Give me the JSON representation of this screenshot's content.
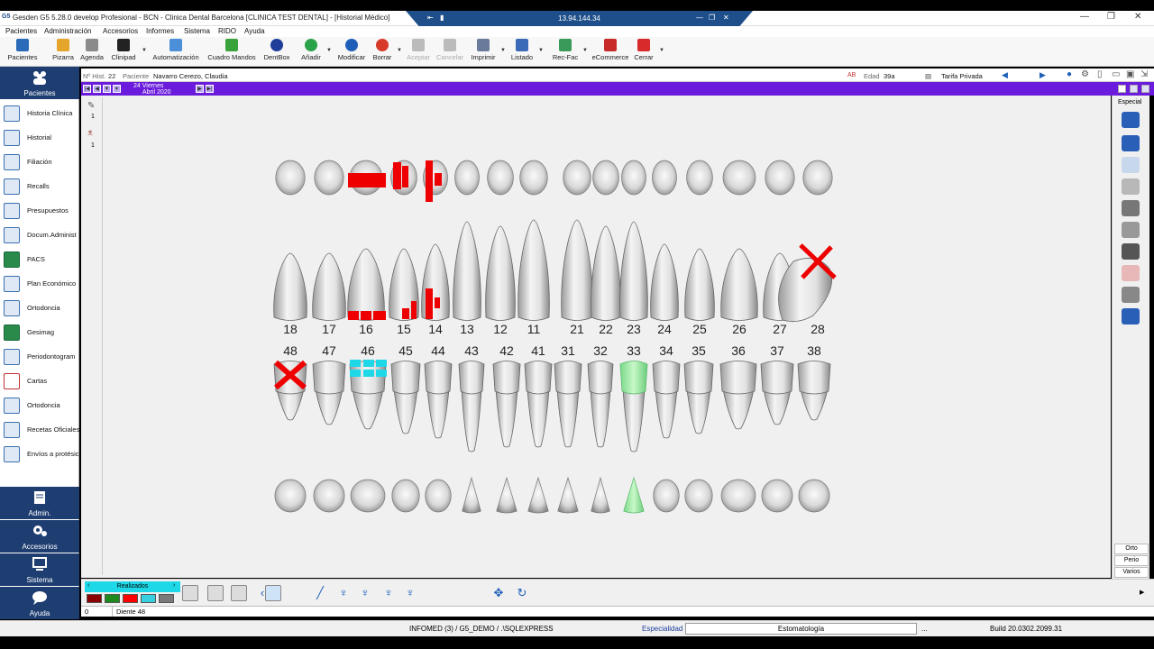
{
  "window": {
    "title": "Gesden G5 5.28.0 develop Profesional - BCN - Clinica Dental Barcelona [CLINICA TEST DENTAL] - [Historial Médico]",
    "logo": "G5",
    "remote_ip": "13.94.144.34"
  },
  "menu": [
    "Pacientes",
    "Administración",
    "Accesorios",
    "Informes",
    "Sistema",
    "RIDO",
    "Ayuda"
  ],
  "toolbar": [
    {
      "label": "Pacientes",
      "icon": "patients-icon",
      "color": "#2a6ab8",
      "enabled": true
    },
    {
      "label": "Pizarra",
      "icon": "folder-icon",
      "color": "#e5a52a",
      "enabled": true
    },
    {
      "label": "Agenda",
      "icon": "agenda-icon",
      "color": "#8a8a8a",
      "enabled": true
    },
    {
      "label": "Clinipad",
      "icon": "tablet-icon",
      "color": "#222222",
      "enabled": true
    },
    {
      "label": "Automatización",
      "icon": "gears-icon",
      "color": "#4a8fd8",
      "enabled": true
    },
    {
      "label": "Cuadro Mandos",
      "icon": "dashboard-icon",
      "color": "#3aa23a",
      "enabled": true
    },
    {
      "label": "DentBox",
      "icon": "dentbox-icon",
      "color": "#1e3e9a",
      "enabled": true
    },
    {
      "label": "Añadir",
      "icon": "add-icon",
      "color": "#2aa24a",
      "enabled": true
    },
    {
      "label": "Modificar",
      "icon": "modify-icon",
      "color": "#1f5fb8",
      "enabled": true
    },
    {
      "label": "Borrar",
      "icon": "delete-icon",
      "color": "#d83a2a",
      "enabled": true
    },
    {
      "label": "Aceptar",
      "icon": "check-icon",
      "color": "#bbbbbb",
      "enabled": false
    },
    {
      "label": "Cancelar",
      "icon": "cancel-icon",
      "color": "#bbbbbb",
      "enabled": false
    },
    {
      "label": "Imprimir",
      "icon": "printer-icon",
      "color": "#6a7a9a",
      "enabled": true
    },
    {
      "label": "Listado",
      "icon": "list-icon",
      "color": "#3a6ab8",
      "enabled": true
    },
    {
      "label": "Rec-Fac",
      "icon": "invoice-icon",
      "color": "#3a9a5a",
      "enabled": true
    },
    {
      "label": "eCommerce",
      "icon": "ecommerce-icon",
      "color": "#c82a2a",
      "enabled": true
    },
    {
      "label": "Cerrar",
      "icon": "close-icon",
      "color": "#d82a2a",
      "enabled": true
    }
  ],
  "leftnav": {
    "header": "Pacientes",
    "items": [
      "Historia Clínica",
      "Historial",
      "Filiación",
      "Recalls",
      "Presupuestos",
      "Docum.Administ",
      "PACS",
      "Plan Económico",
      "Ortodoncia",
      "Gesimag",
      "Periodontogram",
      "Cartas",
      "Ortodoncia",
      "Recetas Oficiales",
      "Envíos a protésic"
    ],
    "sections": [
      "Admin.",
      "Accesorios",
      "Sistema",
      "Ayuda"
    ]
  },
  "patient": {
    "nhist_label": "Nº Hist.",
    "nhist": "22",
    "paciente_label": "Paciente",
    "name": "Navarro Cerezo, Claudia",
    "edad_label": "Edad",
    "edad": "39a",
    "tarifa": "Tarifa Privada"
  },
  "datebar": {
    "day": "24 Viernes",
    "month": "Abril 2020"
  },
  "lefttools": [
    "1",
    "1"
  ],
  "rightpanel": {
    "top_label": "Especial",
    "bottom": [
      "Orto",
      "Perio",
      "Varios"
    ]
  },
  "upper_numbers": [
    "18",
    "17",
    "16",
    "15",
    "14",
    "13",
    "12",
    "11",
    "21",
    "22",
    "23",
    "24",
    "25",
    "26",
    "27",
    "28"
  ],
  "lower_numbers": [
    "48",
    "47",
    "46",
    "45",
    "44",
    "43",
    "42",
    "41",
    "31",
    "32",
    "33",
    "34",
    "35",
    "36",
    "37",
    "38"
  ],
  "bottom": {
    "realizados": "Realizados",
    "status_value": "0",
    "status_tooth": "Diente 48",
    "swatches": [
      "#8b0000",
      "#1e8a1e",
      "#ff0000",
      "#38d0e0",
      "#7a7a7a"
    ]
  },
  "footer": {
    "server": "INFOMED (3) / G5_DEMO / .\\SQLEXPRESS",
    "especialidad_label": "Especialidad",
    "especialidad": "Estomatología",
    "dots": "...",
    "build": "Build 20.0302.2099.31"
  }
}
